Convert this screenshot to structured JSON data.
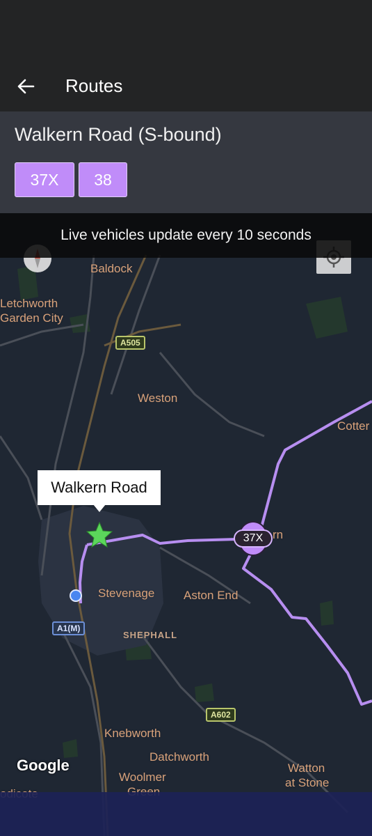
{
  "app_bar": {
    "title": "Routes",
    "back_icon": "arrow-left-icon"
  },
  "stop": {
    "name": "Walkern Road (S-bound)",
    "routes": [
      "37X",
      "38"
    ],
    "chip_color": "#c08cf9"
  },
  "banner": {
    "text": "Live vehicles update every 10 seconds"
  },
  "map": {
    "attribution": "Google",
    "compass_icon": "compass-icon",
    "locate_icon": "my-location-icon",
    "stop_callout": "Walkern Road",
    "bus_marker_label": "37X",
    "route_line_color": "#b78ef0",
    "places": {
      "baldock": "Baldock",
      "letchworth_1": "Letchworth",
      "letchworth_2": "Garden City",
      "weston": "Weston",
      "cotter": "Cotter",
      "walkern_partial": "rn",
      "stevenage": "Stevenage",
      "aston_end": "Aston End",
      "shephall": "SHEPHALL",
      "knebworth": "Knebworth",
      "datchworth": "Datchworth",
      "woolmer_1": "Woolmer",
      "woolmer_2": "Green",
      "watton_1": "Watton",
      "watton_2": "at Stone",
      "codicote_partial": "odicote"
    },
    "road_labels": {
      "a505": "A505",
      "a1m": "A1(M)",
      "a602": "A602"
    }
  }
}
